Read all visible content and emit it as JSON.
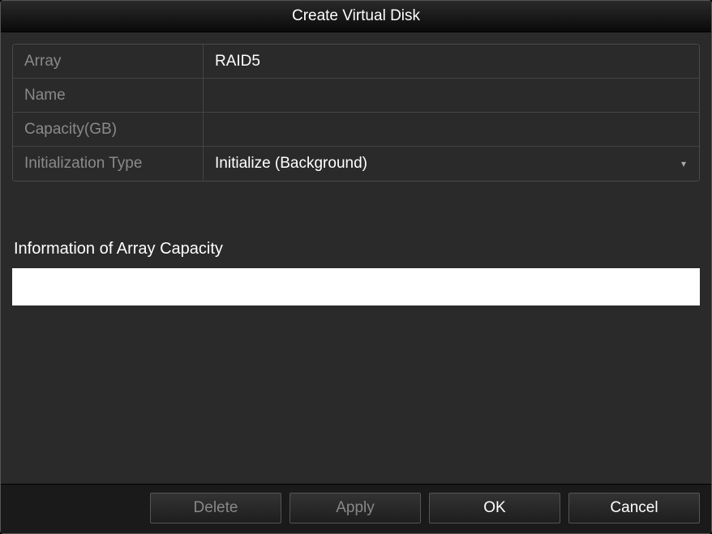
{
  "title": "Create Virtual Disk",
  "form": {
    "array": {
      "label": "Array",
      "value": "RAID5"
    },
    "name": {
      "label": "Name",
      "value": ""
    },
    "capacity": {
      "label": "Capacity(GB)",
      "value": ""
    },
    "init_type": {
      "label": "Initialization Type",
      "value": "Initialize (Background)"
    }
  },
  "section": {
    "info_label": "Information of Array Capacity",
    "info_value": ""
  },
  "buttons": {
    "delete": "Delete",
    "apply": "Apply",
    "ok": "OK",
    "cancel": "Cancel"
  }
}
